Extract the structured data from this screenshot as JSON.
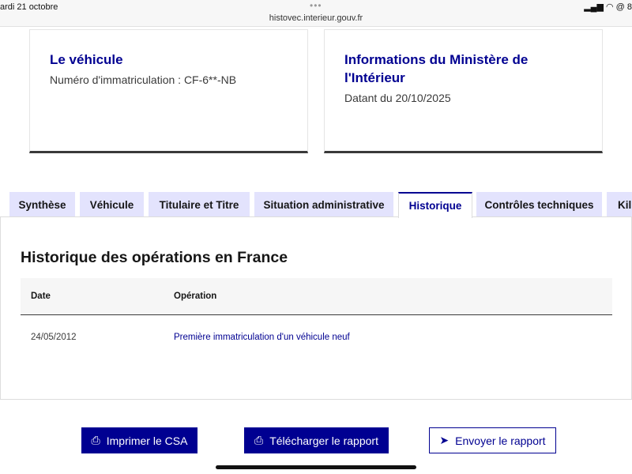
{
  "status_bar": {
    "date": "ardi 21 octobre",
    "url": "histovec.interieur.gouv.fr",
    "battery": "8"
  },
  "cards": [
    {
      "title": "Le véhicule",
      "text": "Numéro d'immatriculation : CF-6**-NB"
    },
    {
      "title_line1": "Informations du Ministère de",
      "title_line2": "l'Intérieur",
      "text": "Datant du 20/10/2025"
    }
  ],
  "tabs": [
    "Synthèse",
    "Véhicule",
    "Titulaire et Titre",
    "Situation administrative",
    "Historique",
    "Contrôles techniques",
    "Kil"
  ],
  "active_tab": "Historique",
  "section": {
    "title": "Historique des opérations en France",
    "columns": [
      "Date",
      "Opération"
    ],
    "rows": [
      {
        "date": "24/05/2012",
        "operation": "Première immatriculation d'un véhicule neuf"
      }
    ]
  },
  "buttons": {
    "print": "Imprimer le CSA",
    "download": "Télécharger le rapport",
    "send": "Envoyer le rapport"
  },
  "colors": {
    "accent": "#000091",
    "tab_bg": "#e3e3fd"
  }
}
